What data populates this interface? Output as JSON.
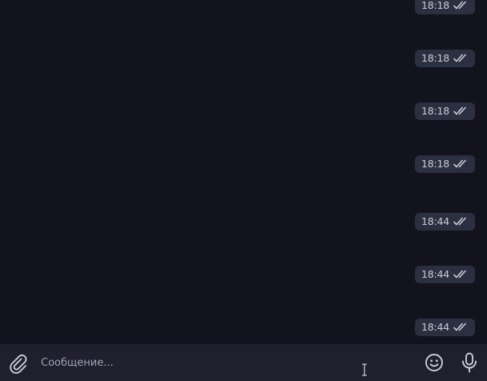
{
  "messages": [
    {
      "time": "18:18",
      "status_icon": "double-check-icon"
    },
    {
      "time": "18:18",
      "status_icon": "double-check-icon"
    },
    {
      "time": "18:18",
      "status_icon": "double-check-icon"
    },
    {
      "time": "18:18",
      "status_icon": "double-check-icon"
    },
    {
      "time": "18:44",
      "status_icon": "double-check-icon"
    },
    {
      "time": "18:44",
      "status_icon": "double-check-icon"
    },
    {
      "time": "18:44",
      "status_icon": "double-check-icon"
    }
  ],
  "composer": {
    "placeholder": "Сообщение...",
    "value": "",
    "attach_icon": "paperclip-icon",
    "emoji_icon": "smile-icon",
    "mic_icon": "microphone-icon"
  },
  "colors": {
    "background": "#13131d",
    "composer_background": "#1f1f2d",
    "badge_background": "#2b2f3f",
    "badge_text": "#c8ccd8",
    "icon": "#c9ccd6"
  }
}
